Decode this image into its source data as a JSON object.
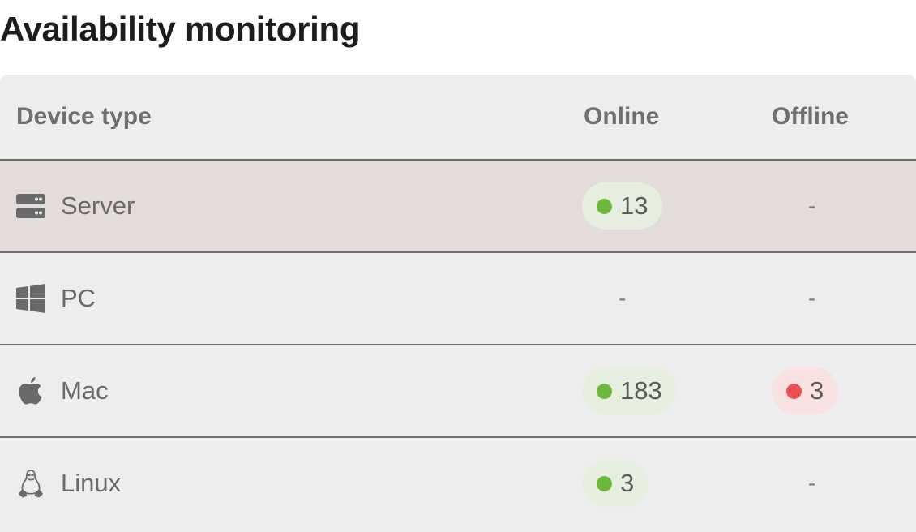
{
  "page": {
    "title": "Availability monitoring"
  },
  "table": {
    "headers": {
      "device_type": "Device type",
      "online": "Online",
      "offline": "Offline"
    },
    "rows": [
      {
        "label": "Server",
        "icon": "server-icon",
        "online": "13",
        "offline": "-",
        "selected": true
      },
      {
        "label": "PC",
        "icon": "windows-icon",
        "online": "-",
        "offline": "-",
        "selected": false
      },
      {
        "label": "Mac",
        "icon": "apple-icon",
        "online": "183",
        "offline": "3",
        "selected": false
      },
      {
        "label": "Linux",
        "icon": "linux-penguin-icon",
        "online": "3",
        "offline": "-",
        "selected": false
      }
    ]
  },
  "colors": {
    "online_dot": "#6cb83a",
    "online_badge": "#e6efdf",
    "offline_dot": "#ee4f57",
    "offline_badge": "#f8e1e1",
    "selected_row": "#e4dcdb",
    "card_background": "#ededed"
  }
}
